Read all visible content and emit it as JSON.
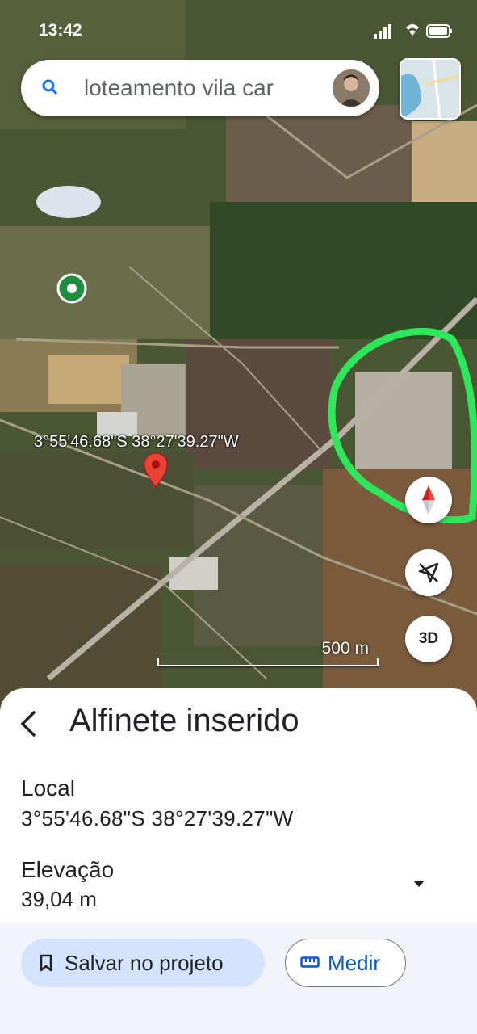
{
  "status_bar": {
    "time": "13:42"
  },
  "search": {
    "query": "loteamento vila car"
  },
  "map": {
    "coordinate_label": "3°55'46.68\"S 38°27'39.27\"W",
    "scale_label": "500 m",
    "button_3d": "3D"
  },
  "sheet": {
    "title": "Alfinete inserido",
    "local_label": "Local",
    "local_value": "3°55'46.68\"S 38°27'39.27\"W",
    "elevation_label": "Elevação",
    "elevation_value": "39,04 m",
    "save_label": "Salvar no projeto",
    "measure_label": "Medir"
  },
  "colors": {
    "accent_blue": "#0b57d0",
    "save_bg": "#d3e3fd",
    "pin_red": "#ea4335",
    "highlight_green": "#2ee65a"
  }
}
